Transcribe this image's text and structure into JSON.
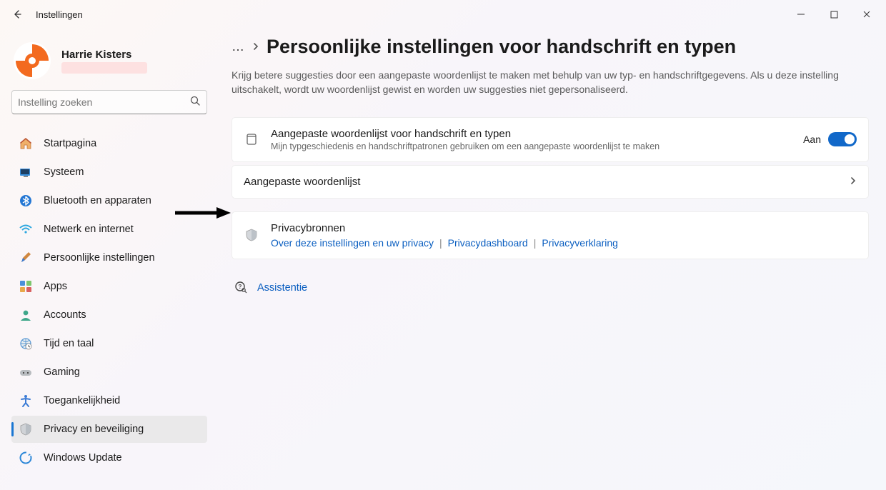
{
  "app_title": "Instellingen",
  "user_name": "Harrie Kisters",
  "search_placeholder": "Instelling zoeken",
  "nav": [
    {
      "id": "home",
      "label": "Startpagina"
    },
    {
      "id": "system",
      "label": "Systeem"
    },
    {
      "id": "bt",
      "label": "Bluetooth en apparaten"
    },
    {
      "id": "net",
      "label": "Netwerk en internet"
    },
    {
      "id": "personal",
      "label": "Persoonlijke instellingen"
    },
    {
      "id": "apps",
      "label": "Apps"
    },
    {
      "id": "accounts",
      "label": "Accounts"
    },
    {
      "id": "time",
      "label": "Tijd en taal"
    },
    {
      "id": "gaming",
      "label": "Gaming"
    },
    {
      "id": "access",
      "label": "Toegankelijkheid"
    },
    {
      "id": "privacy",
      "label": "Privacy en beveiliging"
    },
    {
      "id": "update",
      "label": "Windows Update"
    }
  ],
  "breadcrumb_dots": "…",
  "page_title": "Persoonlijke instellingen voor handschrift en typen",
  "page_desc": "Krijg betere suggesties door een aangepaste woordenlijst te maken met behulp van uw typ- en handschriftgegevens. Als u deze instelling uitschakelt, wordt uw woordenlijst gewist en worden uw suggesties niet gepersonaliseerd.",
  "card_toggle": {
    "title": "Aangepaste woordenlijst voor handschrift en typen",
    "sub": "Mijn typgeschiedenis en handschriftpatronen gebruiken om een aangepaste woordenlijst te maken",
    "state_label": "Aan"
  },
  "card_nav": {
    "title": "Aangepaste woordenlijst"
  },
  "card_privacy": {
    "title": "Privacybronnen",
    "links": [
      "Over deze instellingen en uw privacy",
      "Privacydashboard",
      "Privacyverklaring"
    ]
  },
  "assist_label": "Assistentie"
}
